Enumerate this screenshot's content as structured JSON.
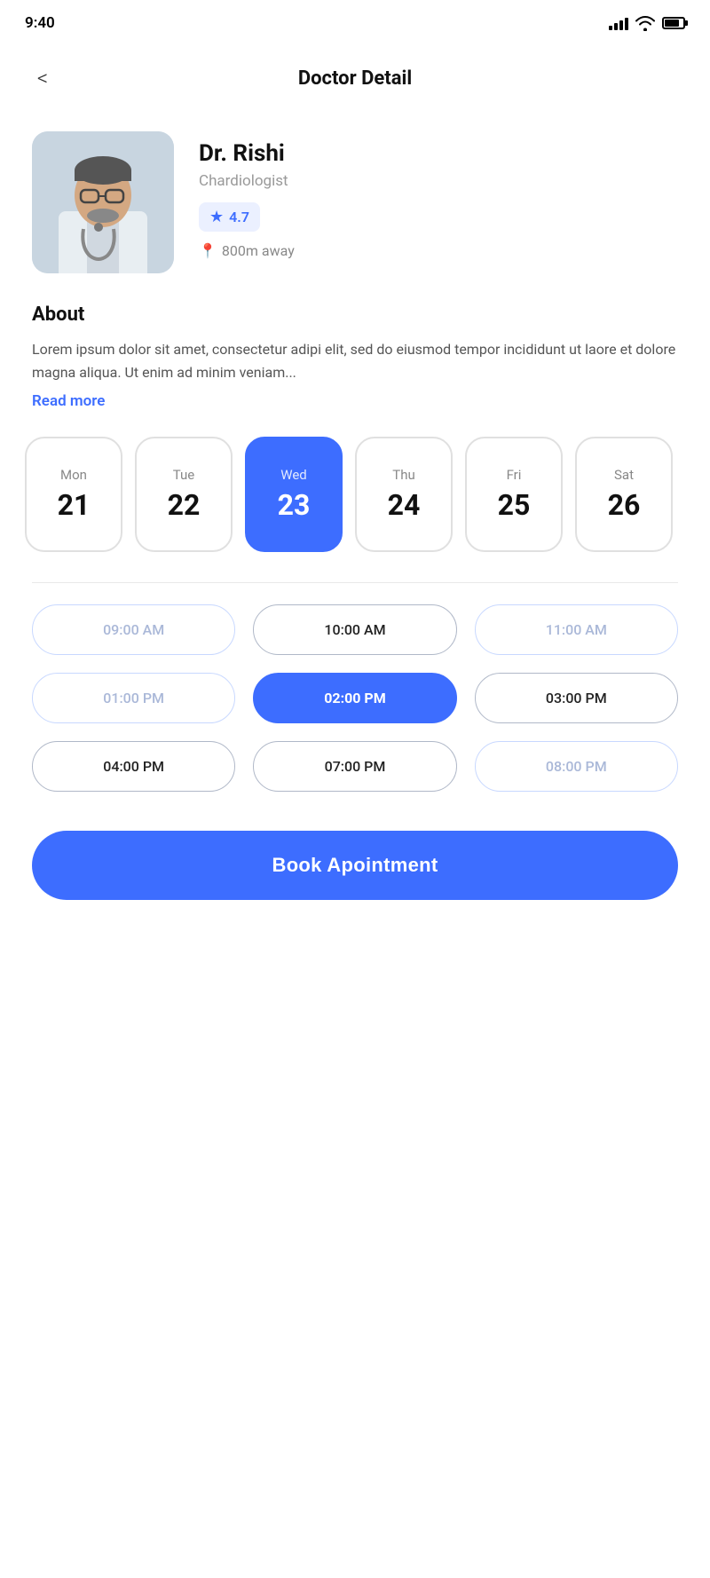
{
  "statusBar": {
    "time": "9:40"
  },
  "header": {
    "title": "Doctor Detail",
    "backLabel": "<"
  },
  "doctor": {
    "name": "Dr. Rishi",
    "specialty": "Chardiologist",
    "rating": "4.7",
    "distance": "800m away"
  },
  "about": {
    "title": "About",
    "text": "Lorem ipsum dolor sit amet, consectetur adipi elit, sed do eiusmod tempor incididunt ut laore et dolore magna aliqua. Ut enim ad minim veniam...",
    "readMore": "Read more"
  },
  "calendar": {
    "days": [
      {
        "name": "Mon",
        "number": "21",
        "selected": false
      },
      {
        "name": "Tue",
        "number": "22",
        "selected": false
      },
      {
        "name": "Wed",
        "number": "23",
        "selected": true
      },
      {
        "name": "Thu",
        "number": "24",
        "selected": false
      },
      {
        "name": "Fri",
        "number": "25",
        "selected": false
      },
      {
        "name": "Sat",
        "number": "26",
        "selected": false
      }
    ]
  },
  "timeSlots": [
    {
      "time": "09:00 AM",
      "state": "disabled"
    },
    {
      "time": "10:00 AM",
      "state": "available"
    },
    {
      "time": "11:00 AM",
      "state": "disabled"
    },
    {
      "time": "01:00 PM",
      "state": "disabled"
    },
    {
      "time": "02:00 PM",
      "state": "selected"
    },
    {
      "time": "03:00 PM",
      "state": "available"
    },
    {
      "time": "04:00 PM",
      "state": "available"
    },
    {
      "time": "07:00 PM",
      "state": "available"
    },
    {
      "time": "08:00 PM",
      "state": "disabled"
    }
  ],
  "bookButton": {
    "label": "Book Apointment"
  }
}
